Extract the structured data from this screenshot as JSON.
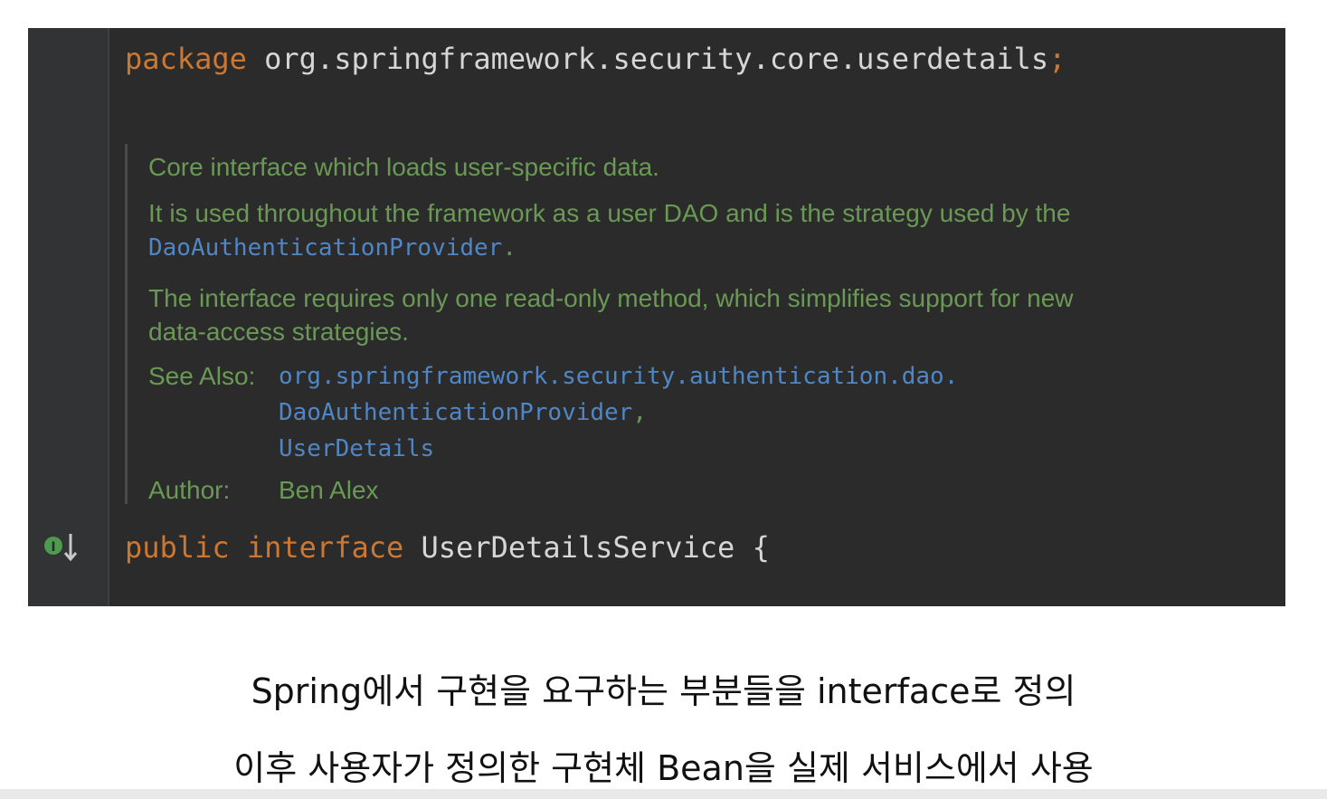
{
  "code": {
    "package_keyword": "package",
    "package_name": "org.springframework.security.core.userdetails",
    "package_semicolon": ";",
    "decl_public": "public",
    "decl_interface": "interface",
    "decl_name": "UserDetailsService",
    "decl_brace": "{"
  },
  "doc": {
    "line1": "Core interface which loads user-specific data.",
    "line2": "It is used throughout the framework as a user DAO and is the strategy used by the",
    "line3_link": "DaoAuthenticationProvider",
    "line3_punct": ".",
    "line4": "The interface requires only one read-only method, which simplifies support for new",
    "line5": "data-access strategies.",
    "see_also_label": "See Also:",
    "see_also_1": "org.springframework.security.authentication.dao.",
    "see_also_2": "DaoAuthenticationProvider",
    "see_also_2_punct": ",",
    "see_also_3": "UserDetails",
    "author_label": "Author:",
    "author_value": "Ben Alex"
  },
  "gutter": {
    "icon": "implemented-interface-icon",
    "icon_letter": "I",
    "icon_color": "#4e9a4e"
  },
  "captions": {
    "line1": "Spring에서 구현을 요구하는 부분들을 interface로 정의",
    "line2": "이후 사용자가 정의한 구현체 Bean을 실제 서비스에서 사용"
  },
  "colors": {
    "editor_bg": "#2b2b2b",
    "keyword": "#cc7832",
    "doc_text": "#6a9955",
    "doc_link": "#4f86c6"
  }
}
